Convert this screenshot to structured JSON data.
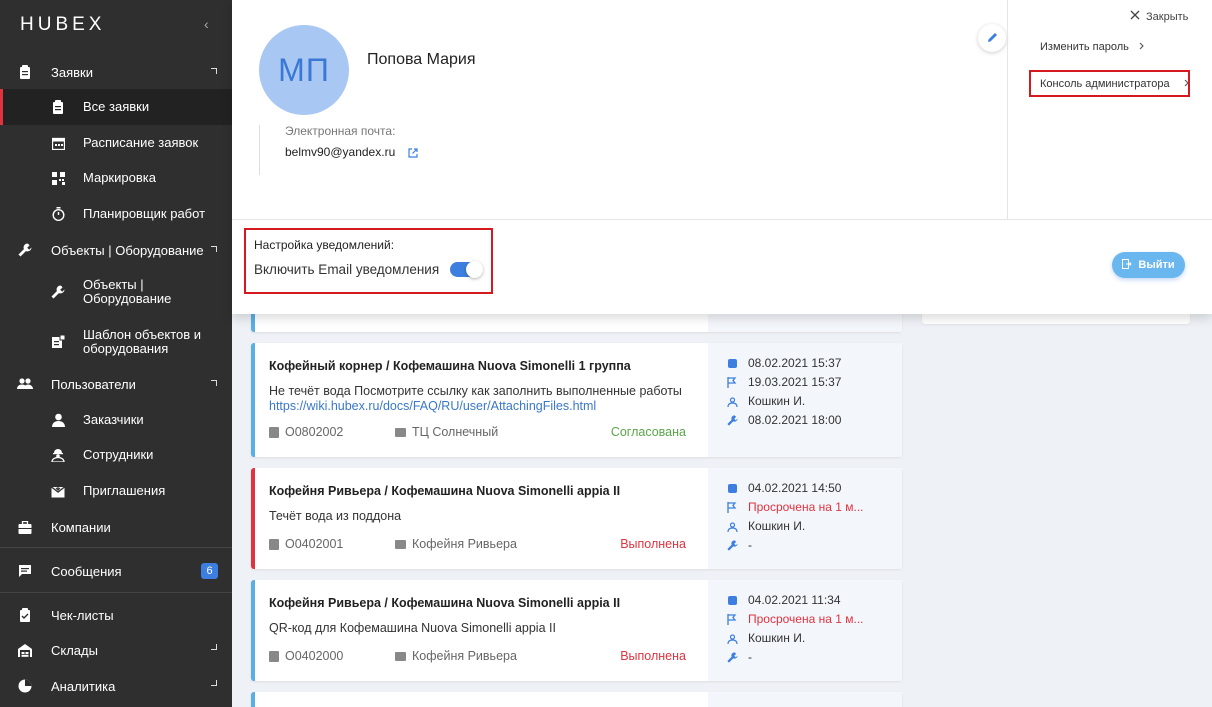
{
  "app": {
    "logo": "HUBEX"
  },
  "sidebar": {
    "items": [
      {
        "label": "Заявки",
        "icon": "clipboard-icon"
      },
      {
        "label": "Все заявки",
        "icon": "clipboard-icon"
      },
      {
        "label": "Расписание заявок",
        "icon": "calendar-icon"
      },
      {
        "label": "Маркировка",
        "icon": "qr-code-icon"
      },
      {
        "label": "Планировщик работ",
        "icon": "stopwatch-icon"
      },
      {
        "label": "Объекты | Оборудование",
        "icon": "wrench-icon"
      },
      {
        "label": "Объекты | Оборудование",
        "icon": "wrench-icon"
      },
      {
        "label": "Шаблон объектов и оборудования",
        "icon": "template-icon"
      },
      {
        "label": "Пользователи",
        "icon": "users-icon"
      },
      {
        "label": "Заказчики",
        "icon": "user-icon"
      },
      {
        "label": "Сотрудники",
        "icon": "worker-icon"
      },
      {
        "label": "Приглашения",
        "icon": "invite-icon"
      },
      {
        "label": "Компании",
        "icon": "briefcase-icon"
      },
      {
        "label": "Сообщения",
        "icon": "message-icon",
        "badge": "6"
      },
      {
        "label": "Чек-листы",
        "icon": "checklist-icon"
      },
      {
        "label": "Склады",
        "icon": "warehouse-icon"
      },
      {
        "label": "Аналитика",
        "icon": "pie-chart-icon"
      }
    ]
  },
  "profile": {
    "initials": "МП",
    "name": "Попова Мария",
    "email_label": "Электронная почта:",
    "email": "belmv90@yandex.ru",
    "close_label": "Закрыть",
    "change_password": "Изменить пароль",
    "admin_console": "Консоль администратора",
    "notif_title": "Настройка уведомлений:",
    "notif_email": "Включить Email уведомления",
    "notif_email_on": true,
    "logout": "Выйти"
  },
  "requests": [
    {
      "title": "Кофейный корнер / Кофемашина Nuova Simonelli 1 группа",
      "desc": "Не течёт вода Посмотрите ссылку как заполнить выполненные работы",
      "link": "https://wiki.hubex.ru/docs/FAQ/RU/user/AttachingFiles.html",
      "number": "O0802002",
      "location": "ТЦ Солнечный",
      "status": "Согласована",
      "created": "08.02.2021 15:37",
      "deadline": "19.03.2021 15:37",
      "assignee": "Кошкин И.",
      "work": "08.02.2021 18:00"
    },
    {
      "title": "Кофейня Ривьера / Кофемашина Nuova Simonelli appia II",
      "desc": "Течёт вода из поддона",
      "link": "",
      "number": "O0402001",
      "location": "Кофейня Ривьера",
      "status": "Выполнена",
      "created": "04.02.2021 14:50",
      "deadline": "Просрочена на 1 м...",
      "assignee": "Кошкин И.",
      "work": "-"
    },
    {
      "title": "Кофейня Ривьера / Кофемашина Nuova Simonelli appia II",
      "desc": "QR-код для Кофемашина Nuova Simonelli appia II",
      "link": "",
      "number": "O0402000",
      "location": "Кофейня Ривьера",
      "status": "Выполнена",
      "created": "04.02.2021 11:34",
      "deadline": "Просрочена на 1 м...",
      "assignee": "Кошкин И.",
      "work": "-"
    }
  ]
}
